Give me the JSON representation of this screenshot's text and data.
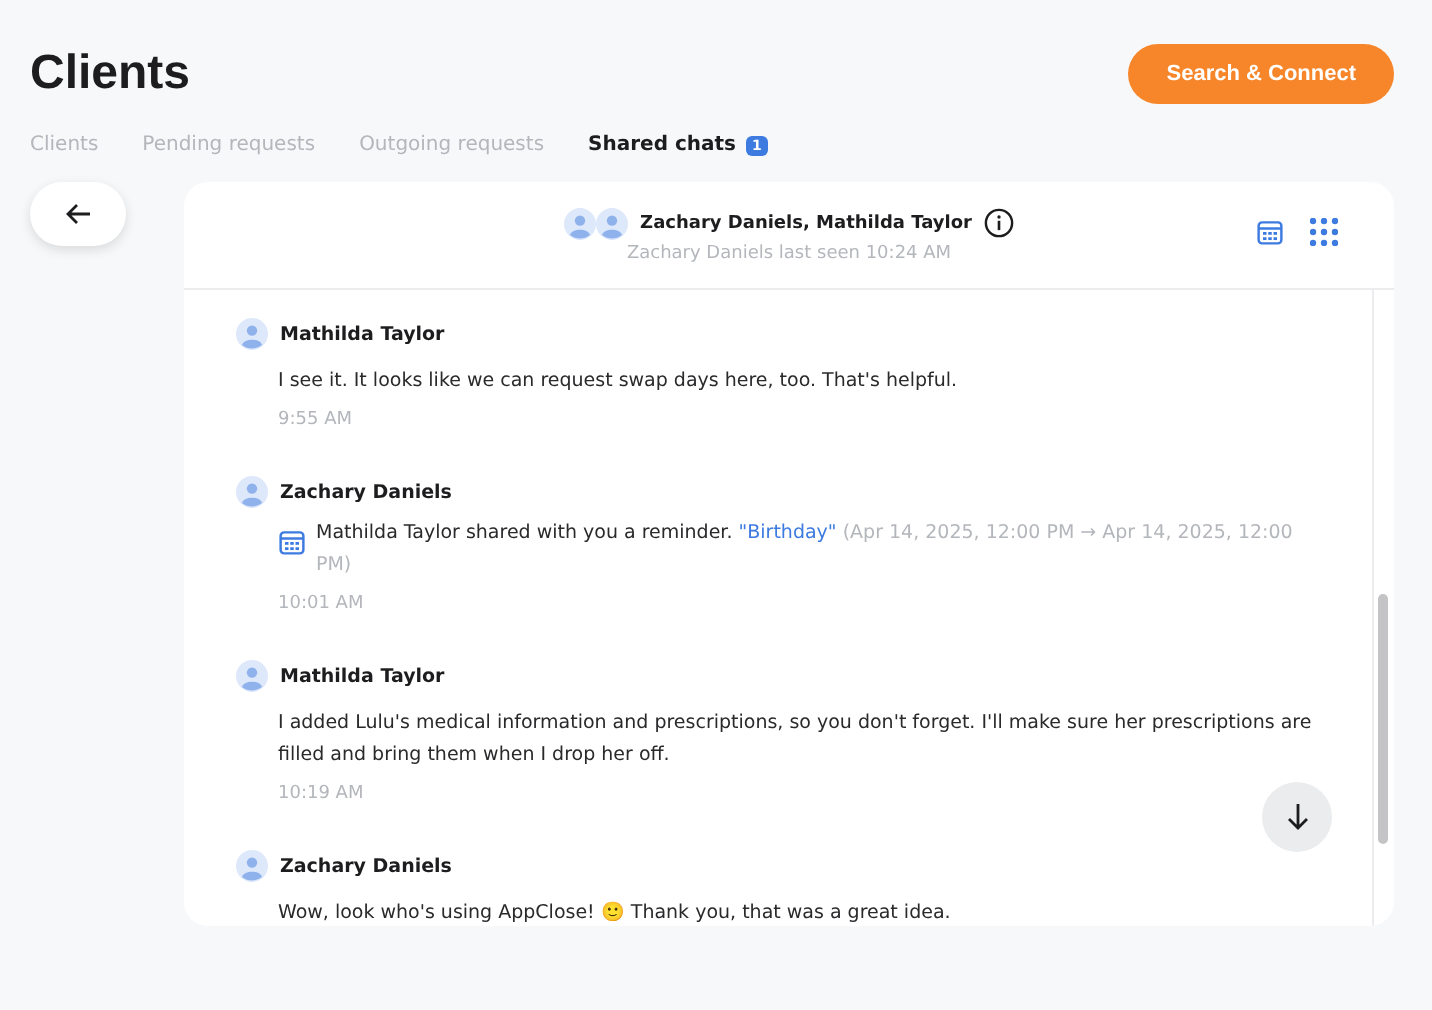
{
  "page": {
    "title": "Clients",
    "action_button": "Search & Connect"
  },
  "tabs": [
    {
      "label": "Clients",
      "selected": false
    },
    {
      "label": "Pending requests",
      "selected": false
    },
    {
      "label": "Outgoing requests",
      "selected": false
    },
    {
      "label": "Shared chats",
      "selected": true,
      "badge": "1"
    }
  ],
  "chat": {
    "title": "Zachary Daniels, Mathilda Taylor",
    "subtitle": "Zachary Daniels last seen 10:24 AM",
    "messages": [
      {
        "kind": "text",
        "sender": "Mathilda Taylor",
        "text": "I see it. It looks like we can request swap days here, too. That's helpful.",
        "time": "9:55 AM"
      },
      {
        "kind": "reminder",
        "sender": "Zachary Daniels",
        "text": "Mathilda Taylor shared with you a reminder.",
        "link": "\"Birthday\"",
        "detail": "(Apr 14, 2025, 12:00 PM → Apr 14, 2025, 12:00 PM)",
        "time": "10:01 AM"
      },
      {
        "kind": "text",
        "sender": "Mathilda Taylor",
        "text": "I added Lulu's medical information and prescriptions, so you don't forget. I'll make sure her prescriptions are filled and bring them when I drop her off.",
        "time": "10:19 AM"
      },
      {
        "kind": "text",
        "sender": "Zachary Daniels",
        "text": "Wow, look who's using AppClose! 🙂 Thank you, that was a great idea."
      }
    ]
  }
}
